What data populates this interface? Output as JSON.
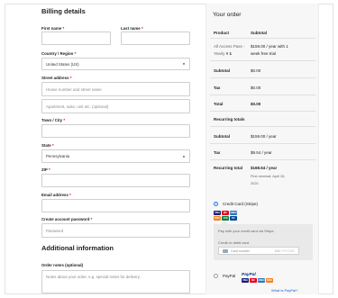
{
  "billing": {
    "heading": "Billing details",
    "first_name_label": "First name",
    "last_name_label": "Last name",
    "country_label": "Country / Region",
    "country_value": "United States (US)",
    "street_label": "Street address",
    "street_placeholder": "House number and street name",
    "street2_placeholder": "Apartment, suite, unit etc. (optional)",
    "city_label": "Town / City",
    "state_label": "State",
    "state_value": "Pennsylvania",
    "zip_label": "ZIP",
    "email_label": "Email address",
    "password_label": "Create account password",
    "password_placeholder": "Password",
    "required_mark": "*"
  },
  "additional": {
    "heading": "Additional information",
    "notes_label": "Order notes (optional)",
    "notes_placeholder": "Notes about your order, e.g. special notes for delivery."
  },
  "order": {
    "heading": "Your order",
    "col_product": "Product",
    "col_subtotal": "Subtotal",
    "item_name_line1": "All Access Pass -",
    "item_name_line2": "Yearly",
    "item_qty": "× 1",
    "item_price_line1": "$159.00 / year with 1",
    "item_price_line2": "week free trial",
    "subtotal_label": "Subtotal",
    "subtotal_value": "$0.00",
    "tax_label": "Tax",
    "tax_value": "$0.00",
    "total_label": "Total",
    "total_value": "$0.00",
    "recurring_heading": "Recurring totals",
    "r_subtotal_label": "Subtotal",
    "r_subtotal_value": "$159.00 / year",
    "r_tax_label": "Tax",
    "r_tax_value": "$9.54 / year",
    "r_total_label": "Recurring total",
    "r_total_value": "$168.54 / year",
    "renewal_line1": "First renewal: April 26,",
    "renewal_line2": "2020"
  },
  "payment": {
    "stripe_label": "Credit Card (Stripe)",
    "stripe_desc": "Pay with your credit card via Stripe.",
    "card_label": "Credit or debit card",
    "card_placeholder": "Card number",
    "card_meta": "MM / YY  CVC",
    "paypal_label": "PayPal",
    "paypal_link": "What is PayPal?",
    "card_logos": [
      {
        "name": "VISA",
        "color": "#1a1f71"
      },
      {
        "name": "MC",
        "color": "#eb001b"
      },
      {
        "name": "AMEX",
        "color": "#2e77bb"
      },
      {
        "name": "DISC",
        "color": "#f58220"
      },
      {
        "name": "JCB",
        "color": "#0b7a3e"
      },
      {
        "name": "DC",
        "color": "#004a97"
      }
    ]
  }
}
